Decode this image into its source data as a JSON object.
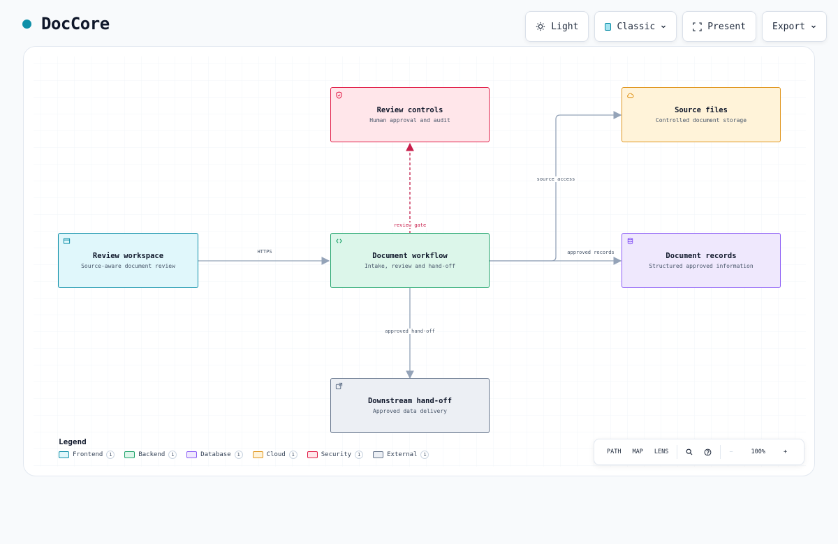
{
  "app": {
    "title": "DocCore"
  },
  "toolbar": {
    "theme_label": "Light",
    "style_label": "Classic",
    "present_label": "Present",
    "export_label": "Export"
  },
  "colors": {
    "accent": "#0e8fa8",
    "frontend": {
      "fill": "#e0f7fb",
      "stroke": "#0e8fa8"
    },
    "backend": {
      "fill": "#dcf6ea",
      "stroke": "#1fa36b"
    },
    "database": {
      "fill": "#efe8fd",
      "stroke": "#8b5cf6"
    },
    "cloud": {
      "fill": "#fff3d9",
      "stroke": "#e0951c"
    },
    "security": {
      "fill": "#ffe6ea",
      "stroke": "#e11d48"
    },
    "external": {
      "fill": "#eceff4",
      "stroke": "#64748b"
    },
    "edge": "#94a3b8",
    "edge_security": "#c81e4b"
  },
  "nodes": {
    "review_controls": {
      "title": "Review controls",
      "subtitle": "Human approval and audit",
      "icon": "shield-icon",
      "category": "security"
    },
    "source_files": {
      "title": "Source files",
      "subtitle": "Controlled document storage",
      "icon": "cloud-icon",
      "category": "cloud"
    },
    "review_workspace": {
      "title": "Review workspace",
      "subtitle": "Source-aware document review",
      "icon": "browser-window-icon",
      "category": "frontend"
    },
    "document_workflow": {
      "title": "Document workflow",
      "subtitle": "Intake, review and hand-off",
      "icon": "code-brackets-icon",
      "category": "backend"
    },
    "document_records": {
      "title": "Document records",
      "subtitle": "Structured approved information",
      "icon": "database-icon",
      "category": "database"
    },
    "downstream_handoff": {
      "title": "Downstream hand-off",
      "subtitle": "Approved data delivery",
      "icon": "external-link-icon",
      "category": "external"
    }
  },
  "edges": {
    "https": "HTTPS",
    "review_gate": "review gate",
    "source_access": "source access",
    "approved_records": "approved records",
    "approved_handoff": "approved hand-off"
  },
  "legend": {
    "title": "Legend",
    "items": [
      {
        "label": "Frontend",
        "count": "1",
        "category": "frontend"
      },
      {
        "label": "Backend",
        "count": "1",
        "category": "backend"
      },
      {
        "label": "Database",
        "count": "1",
        "category": "database"
      },
      {
        "label": "Cloud",
        "count": "1",
        "category": "cloud"
      },
      {
        "label": "Security",
        "count": "1",
        "category": "security"
      },
      {
        "label": "External",
        "count": "1",
        "category": "external"
      }
    ]
  },
  "controls": {
    "path_label": "PATH",
    "map_label": "MAP",
    "lens_label": "LENS",
    "zoom_minus": "−",
    "zoom_level": "100%",
    "zoom_plus": "+"
  }
}
